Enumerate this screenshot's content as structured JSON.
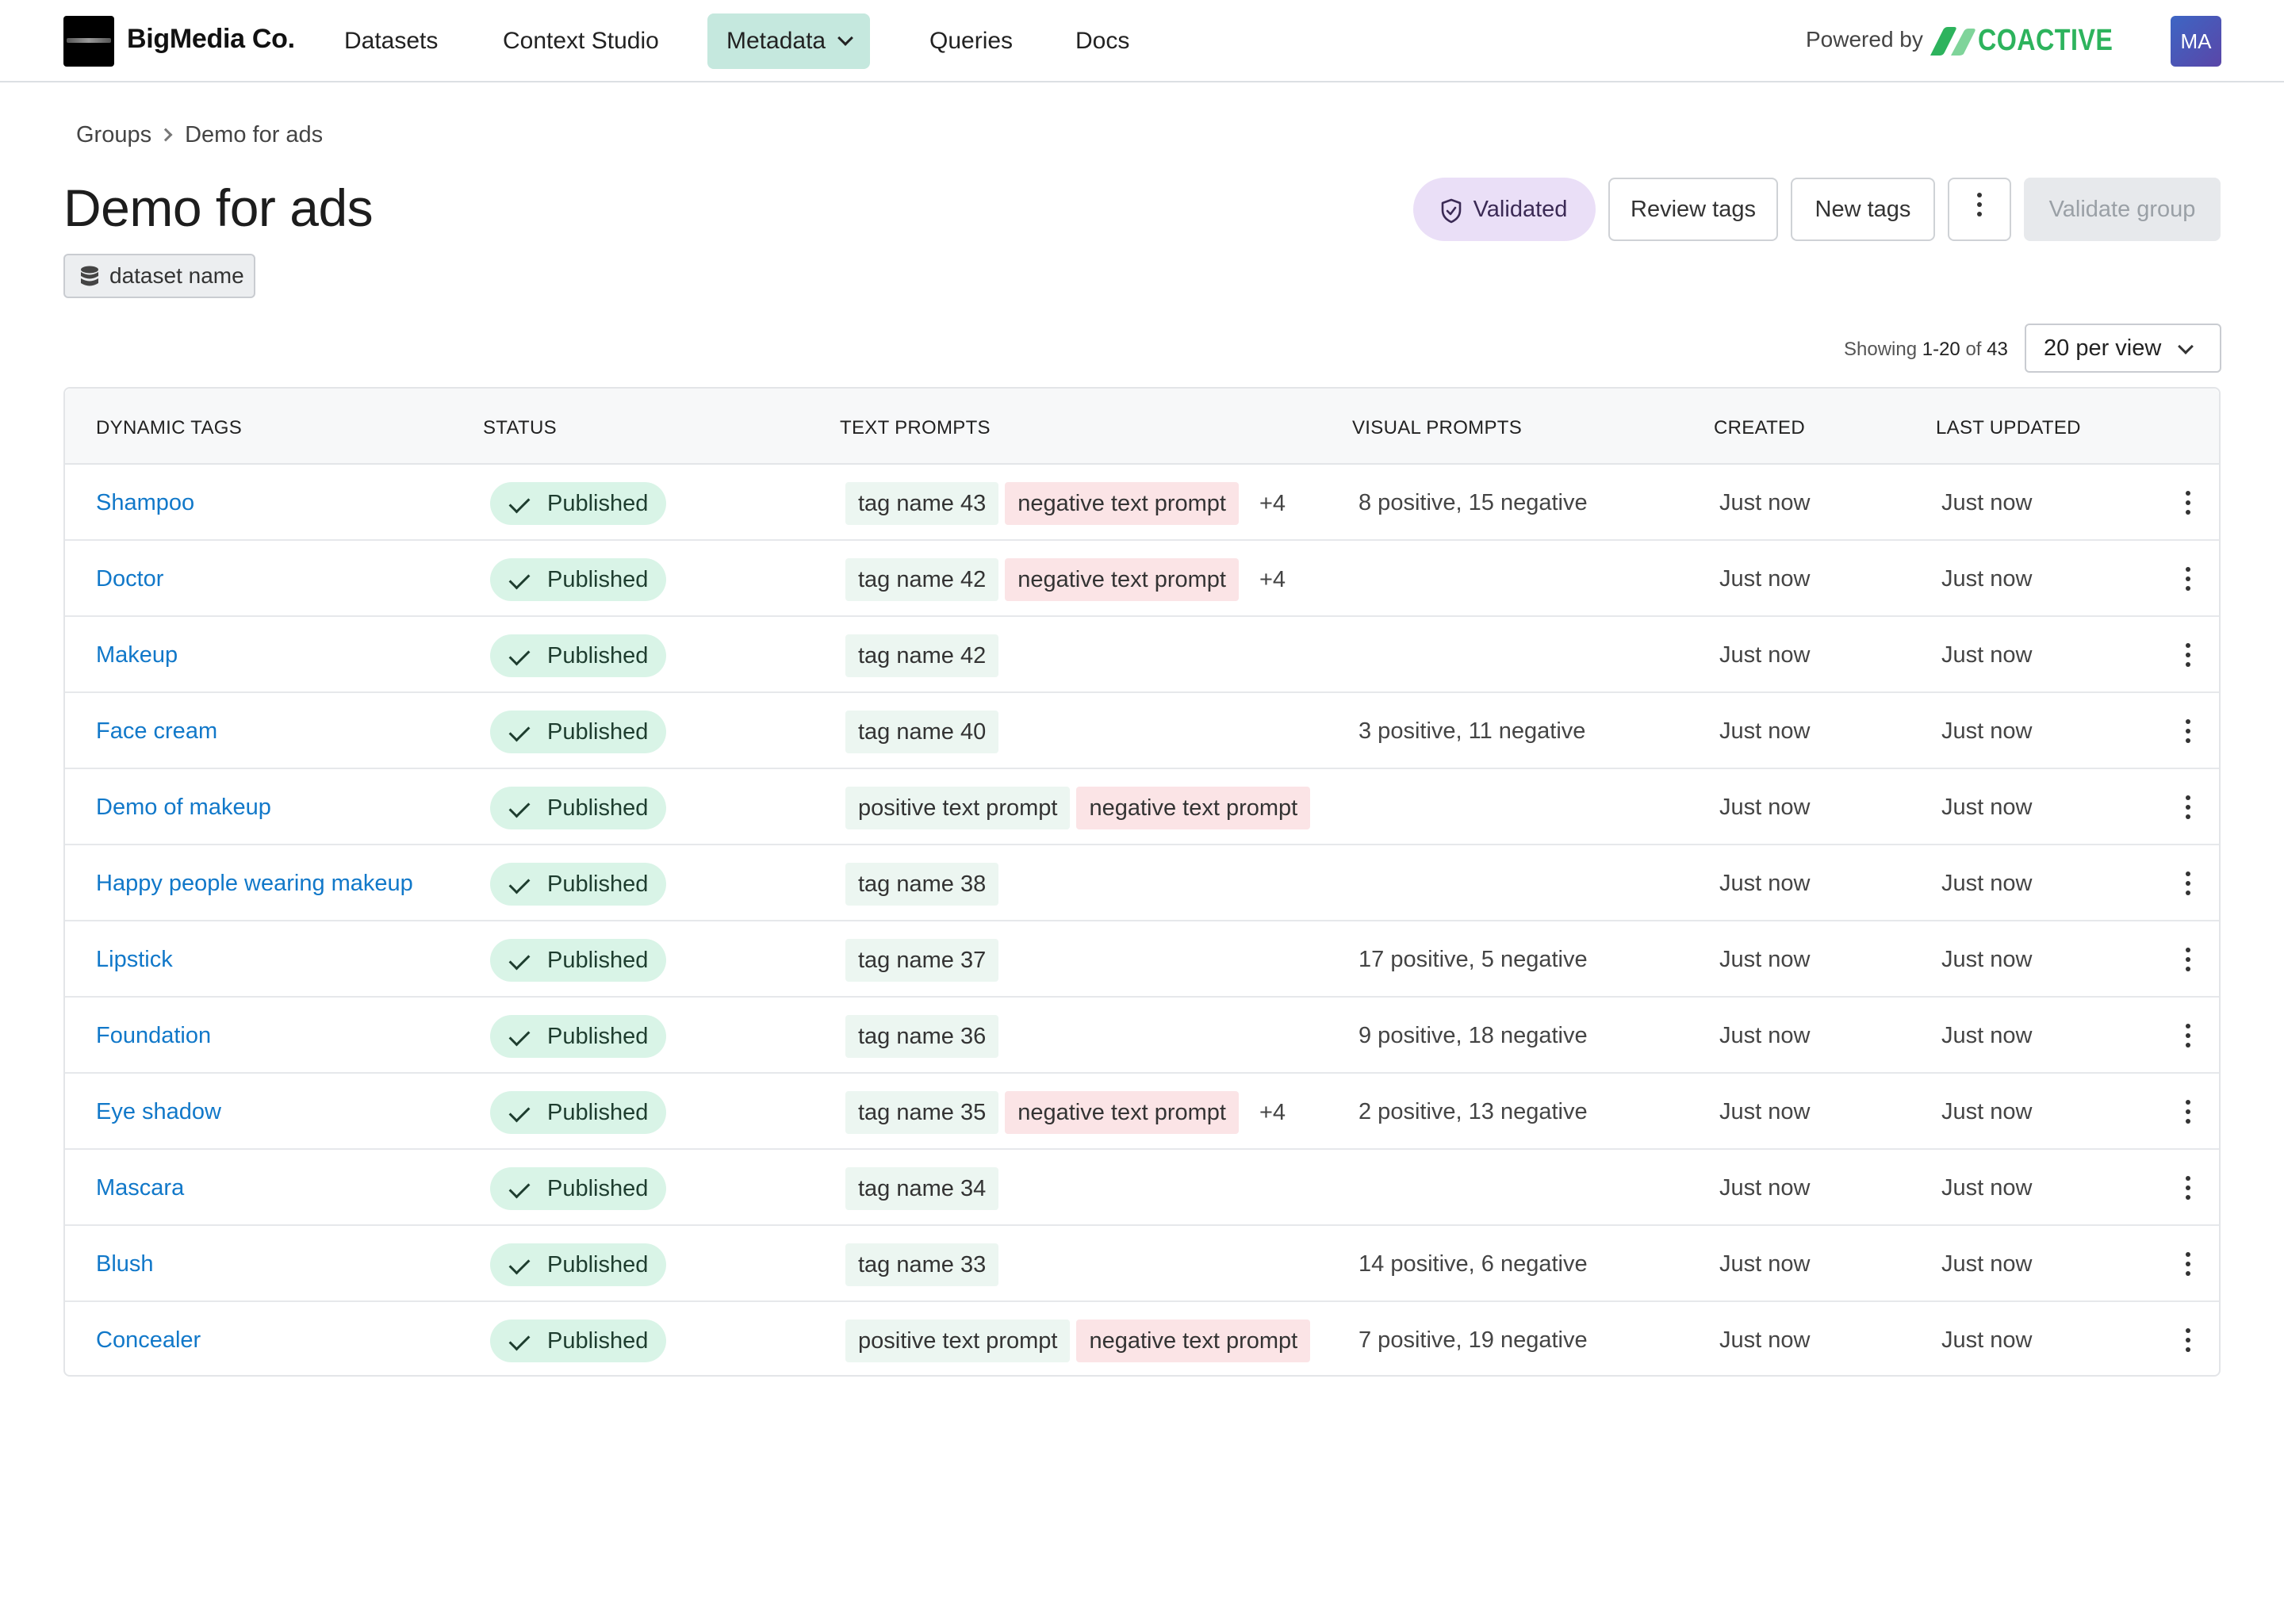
{
  "nav": {
    "brand": "BigMedia Co.",
    "items": [
      {
        "label": "Datasets"
      },
      {
        "label": "Context Studio"
      },
      {
        "label": "Metadata",
        "active": true,
        "icon": "chevron-down-icon"
      },
      {
        "label": "Queries"
      },
      {
        "label": "Docs"
      }
    ],
    "powered_by": "Powered by",
    "partner": "COACTIVE",
    "avatar_initials": "MA"
  },
  "breadcrumb": {
    "parent": "Groups",
    "current": "Demo for ads"
  },
  "page": {
    "title": "Demo for ads",
    "dataset_label": "dataset name"
  },
  "actions": {
    "validated": "Validated",
    "review_tags": "Review tags",
    "new_tags": "New tags",
    "validate_group": "Validate group"
  },
  "pagination": {
    "showing_prefix": "Showing",
    "range": "1-20",
    "of_word": "of",
    "total": "43",
    "per_view": "20 per view"
  },
  "table": {
    "columns": [
      "DYNAMIC TAGS",
      "STATUS",
      "TEXT PROMPTS",
      "VISUAL PROMPTS",
      "CREATED",
      "LAST UPDATED"
    ],
    "rows": [
      {
        "name": "Shampoo",
        "status": "Published",
        "prompts": [
          {
            "text": "tag name 43",
            "kind": "positive"
          },
          {
            "text": "negative text prompt",
            "kind": "negative"
          }
        ],
        "more": "+4",
        "visual": "8 positive, 15 negative",
        "created": "Just now",
        "updated": "Just now"
      },
      {
        "name": "Doctor",
        "status": "Published",
        "prompts": [
          {
            "text": "tag name 42",
            "kind": "positive"
          },
          {
            "text": "negative text prompt",
            "kind": "negative"
          }
        ],
        "more": "+4",
        "visual": "",
        "created": "Just now",
        "updated": "Just now"
      },
      {
        "name": "Makeup",
        "status": "Published",
        "prompts": [
          {
            "text": "tag name 42",
            "kind": "positive"
          }
        ],
        "more": "",
        "visual": "",
        "created": "Just now",
        "updated": "Just now"
      },
      {
        "name": "Face cream",
        "status": "Published",
        "prompts": [
          {
            "text": "tag name 40",
            "kind": "positive"
          }
        ],
        "more": "",
        "visual": "3 positive, 11 negative",
        "created": "Just now",
        "updated": "Just now"
      },
      {
        "name": "Demo of makeup",
        "status": "Published",
        "prompts": [
          {
            "text": "positive text prompt",
            "kind": "positive"
          },
          {
            "text": "negative text prompt",
            "kind": "negative"
          }
        ],
        "more": "",
        "visual": "",
        "created": "Just now",
        "updated": "Just now"
      },
      {
        "name": "Happy people wearing makeup",
        "status": "Published",
        "prompts": [
          {
            "text": "tag name 38",
            "kind": "positive"
          }
        ],
        "more": "",
        "visual": "",
        "created": "Just now",
        "updated": "Just now"
      },
      {
        "name": "Lipstick",
        "status": "Published",
        "prompts": [
          {
            "text": "tag name 37",
            "kind": "positive"
          }
        ],
        "more": "",
        "visual": "17 positive, 5 negative",
        "created": "Just now",
        "updated": "Just now"
      },
      {
        "name": "Foundation",
        "status": "Published",
        "prompts": [
          {
            "text": "tag name 36",
            "kind": "positive"
          }
        ],
        "more": "",
        "visual": "9 positive, 18 negative",
        "created": "Just now",
        "updated": "Just now"
      },
      {
        "name": "Eye shadow",
        "status": "Published",
        "prompts": [
          {
            "text": "tag name 35",
            "kind": "positive"
          },
          {
            "text": "negative text prompt",
            "kind": "negative"
          }
        ],
        "more": "+4",
        "visual": "2 positive, 13 negative",
        "created": "Just now",
        "updated": "Just now"
      },
      {
        "name": "Mascara",
        "status": "Published",
        "prompts": [
          {
            "text": "tag name 34",
            "kind": "positive"
          }
        ],
        "more": "",
        "visual": "",
        "created": "Just now",
        "updated": "Just now"
      },
      {
        "name": "Blush",
        "status": "Published",
        "prompts": [
          {
            "text": "tag name 33",
            "kind": "positive"
          }
        ],
        "more": "",
        "visual": "14 positive, 6 negative",
        "created": "Just now",
        "updated": "Just now"
      },
      {
        "name": "Concealer",
        "status": "Published",
        "prompts": [
          {
            "text": "positive text prompt",
            "kind": "positive"
          },
          {
            "text": "negative text prompt",
            "kind": "negative"
          }
        ],
        "more": "",
        "visual": "7 positive, 19 negative",
        "created": "Just now",
        "updated": "Just now"
      }
    ]
  },
  "colors": {
    "accent_link": "#1178c9",
    "nav_active_bg": "#c5e8de",
    "published_bg": "#d9f4e7",
    "positive_chip_bg": "#ecf6f1",
    "negative_chip_bg": "#fbe4e6",
    "validated_bg": "#eadff7",
    "coactive_green": "#2db35d"
  }
}
